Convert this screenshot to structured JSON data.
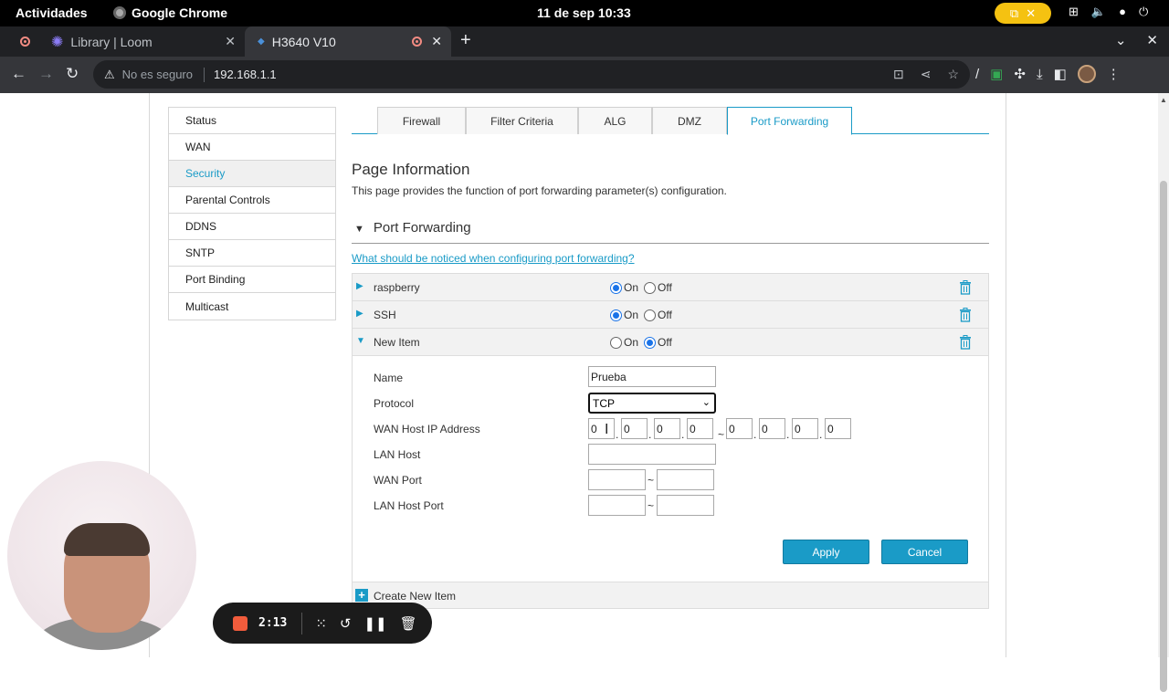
{
  "gnome": {
    "activities": "Actividades",
    "app_name": "Google Chrome",
    "clock": "11 de sep  10:33"
  },
  "browser": {
    "tabs": [
      {
        "title": "Library | Loom"
      },
      {
        "title": "H3640 V10"
      }
    ],
    "security_label": "No es seguro",
    "url": "192.168.1.1"
  },
  "sidebar": {
    "items": [
      {
        "label": "Status"
      },
      {
        "label": "WAN"
      },
      {
        "label": "Security",
        "active": true
      },
      {
        "label": "Parental Controls"
      },
      {
        "label": "DDNS"
      },
      {
        "label": "SNTP"
      },
      {
        "label": "Port Binding"
      },
      {
        "label": "Multicast"
      }
    ]
  },
  "section_tabs": [
    {
      "label": "Firewall"
    },
    {
      "label": "Filter Criteria"
    },
    {
      "label": "ALG"
    },
    {
      "label": "DMZ"
    },
    {
      "label": "Port Forwarding",
      "active": true
    }
  ],
  "page": {
    "title": "Page Information",
    "description": "This page provides the function of port forwarding parameter(s) configuration.",
    "section_heading": "Port Forwarding",
    "notice_link": "What should be noticed when configuring port forwarding?"
  },
  "radio_labels": {
    "on": "On",
    "off": "Off"
  },
  "rules": [
    {
      "name": "raspberry",
      "state": "On"
    },
    {
      "name": "SSH",
      "state": "On"
    },
    {
      "name": "New Item",
      "state": "Off"
    }
  ],
  "form": {
    "labels": {
      "name": "Name",
      "protocol": "Protocol",
      "wan_host_ip": "WAN Host IP Address",
      "lan_host": "LAN Host",
      "wan_port": "WAN Port",
      "lan_host_port": "LAN Host Port"
    },
    "name_value": "Prueba",
    "protocol_value": "TCP",
    "wan_ip_start": [
      "0",
      "0",
      "0",
      "0"
    ],
    "wan_ip_end": [
      "0",
      "0",
      "0",
      "0"
    ],
    "lan_host": "",
    "wan_port_start": "",
    "wan_port_end": "",
    "lan_port_start": "",
    "lan_port_end": "",
    "range_sep": "~",
    "dot": ".",
    "apply": "Apply",
    "cancel": "Cancel"
  },
  "create_new_item": "Create New Item",
  "loom": {
    "timer": "2:13"
  },
  "colors": {
    "accent": "#1a9bc7",
    "record_red": "#f25c3c",
    "gnome_rec": "#f5c211"
  }
}
